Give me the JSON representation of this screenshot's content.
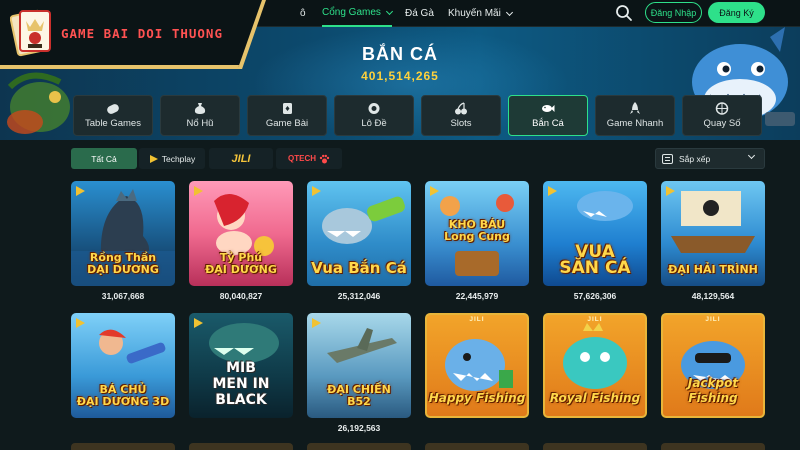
{
  "brand": {
    "name": "GAME BAI DOI THUONG"
  },
  "nav": {
    "items": [
      {
        "label": "ô",
        "active": false,
        "dropdown": false
      },
      {
        "label": "Cổng Games",
        "active": true,
        "dropdown": true
      },
      {
        "label": "Đá Gà",
        "active": false,
        "dropdown": false
      },
      {
        "label": "Khuyến Mãi",
        "active": false,
        "dropdown": true
      }
    ],
    "login_label": "Đăng Nhập",
    "signup_label": "Đăng Ký"
  },
  "banner": {
    "title": "BẮN CÁ",
    "count": "401,514,265"
  },
  "categories": [
    {
      "label": "Table Games",
      "icon": "gamepad-icon",
      "active": false
    },
    {
      "label": "Nổ Hũ",
      "icon": "money-bag-icon",
      "active": false
    },
    {
      "label": "Game Bài",
      "icon": "cards-icon",
      "active": false
    },
    {
      "label": "Lô Đề",
      "icon": "lottery-ball-icon",
      "active": false
    },
    {
      "label": "Slots",
      "icon": "cherry-icon",
      "active": false
    },
    {
      "label": "Bắn Cá",
      "icon": "fish-icon",
      "active": true
    },
    {
      "label": "Game Nhanh",
      "icon": "rocket-icon",
      "active": false
    },
    {
      "label": "Quay Số",
      "icon": "wheel-icon",
      "active": false
    }
  ],
  "filters": {
    "all_label": "Tất Cả",
    "techplay_label": "Techplay",
    "jili_label": "JILI",
    "qtech_label": "QTECH",
    "sort_label": "Sắp xếp"
  },
  "games_row1": [
    {
      "name": "Rồng Thần\nDẠI DƯƠNG",
      "count": "31,067,668",
      "jili": false
    },
    {
      "name": "Tỷ Phú\nĐẠI DƯƠNG",
      "count": "80,040,827",
      "jili": false
    },
    {
      "name": "Vua Bắn Cá",
      "count": "25,312,046",
      "jili": false
    },
    {
      "name": "KHO BÁU\nLong Cung",
      "count": "22,445,979",
      "jili": false
    },
    {
      "name": "VUA\nSĂN CÁ",
      "count": "57,626,306",
      "jili": false
    },
    {
      "name": "ĐẠI HẢI TRÌNH",
      "count": "48,129,564",
      "jili": false
    }
  ],
  "games_row2": [
    {
      "name": "BÁ CHỦ\nĐẠI DƯƠNG 3D",
      "count": "",
      "jili": false
    },
    {
      "name": "MIB\nMEN IN BLACK",
      "count": "",
      "jili": false
    },
    {
      "name": "ĐẠI CHIẾN\nB52",
      "count": "26,192,563",
      "jili": false
    },
    {
      "name": "Happy Fishing",
      "count": "",
      "jili": true
    },
    {
      "name": "Royal Fishing",
      "count": "",
      "jili": true
    },
    {
      "name": "Jackpot Fishing",
      "count": "",
      "jili": true
    }
  ],
  "jili_tag": "JILI",
  "colors": {
    "accent": "#2ee08a",
    "gold": "#ffd23c",
    "bg": "#0f1a1c"
  }
}
